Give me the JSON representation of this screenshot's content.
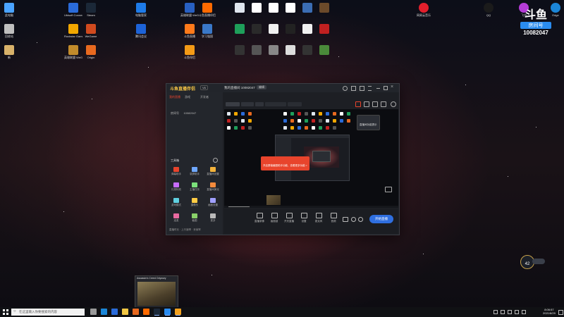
{
  "colors": {
    "accent": "#e8442c",
    "taskbar": "#101114",
    "window_bg": "#1d1f24",
    "primary_btn": "#2f6fe0"
  },
  "desktop": {
    "icons_col1": [
      {
        "label": "此电脑",
        "color": "#4aa3ff"
      },
      {
        "label": "回收站",
        "color": "#bfbfbf"
      },
      {
        "label": "新",
        "color": "#d8b26a"
      }
    ],
    "icons_col2": [
      {
        "label": "Ubisoft Connect",
        "color": "#2a6bd9"
      },
      {
        "label": "Rockstar Games...",
        "color": "#f2a700"
      },
      {
        "label": "英雄联盟 WeGame",
        "color": "#c28b2b"
      }
    ],
    "icons_col3": [
      {
        "label": "Steam",
        "color": "#1b2838"
      },
      {
        "label": "WeGame",
        "color": "#d04a1e"
      },
      {
        "label": "Origin",
        "color": "#e8691f"
      }
    ],
    "icons_col4": [
      {
        "label": "电脑管家",
        "color": "#1e7be8"
      },
      {
        "label": "腾讯会议",
        "color": "#1d63d8"
      }
    ],
    "icons_col5": [
      {
        "label": "英雄联盟 WeGame",
        "color": "#2860c2"
      },
      {
        "label": "斗鱼直播",
        "color": "#ff7a1a"
      },
      {
        "label": "斗鱼伴侣",
        "color": "#f49a16"
      }
    ],
    "icons_col6": [
      {
        "label": "斗鱼直播伴侣",
        "color": "#ff6a00"
      },
      {
        "label": "学习强国",
        "color": "#3a78c8"
      }
    ],
    "right_icons": [
      {
        "label": "网易云音乐",
        "color": "#e21f2c"
      },
      {
        "label": "QQ",
        "color": "#1b1b1b"
      },
      {
        "label": "飞书",
        "color": "#b43cd6"
      },
      {
        "label": "Edge",
        "color": "#1b86d8"
      }
    ],
    "watermark_room": "10082047",
    "watermark_text": "房间号"
  },
  "app": {
    "logo": "斗鱼直播伴侣",
    "version": "V6",
    "room_title": "我的直播间 10082047",
    "edit": "编辑",
    "tabs": [
      "我的直播",
      "游戏",
      "开发者"
    ],
    "side_section": "工具箱",
    "room_label": "房间号",
    "room_id": "10082047",
    "tools": [
      "弹幕助手",
      "录屏助手",
      "直播间设置",
      "礼物特效",
      "主播任务",
      "直播间美化",
      "游戏模式",
      "摄像头",
      "画面设置",
      "连麦",
      "截图",
      "更多"
    ],
    "bottom_tabs": [
      "直播录像",
      "画面锁",
      "开关直播",
      "设置",
      "麦克风",
      "音频"
    ],
    "start_btn": "开始直播",
    "status_items": [
      "直播时长",
      "上行速率",
      "丢帧率"
    ],
    "popup_text": "开启屏幕截图助手功能，查看更多功能 >",
    "side_popup": "直播间功能提示"
  },
  "taskbar": {
    "search_placeholder": "在这里输入你要搜索的内容",
    "time": "8:06:57",
    "date": "2021/8/29",
    "thumb_title": "Assassin's Creed Odyssey"
  },
  "floating": {
    "value": "42"
  }
}
